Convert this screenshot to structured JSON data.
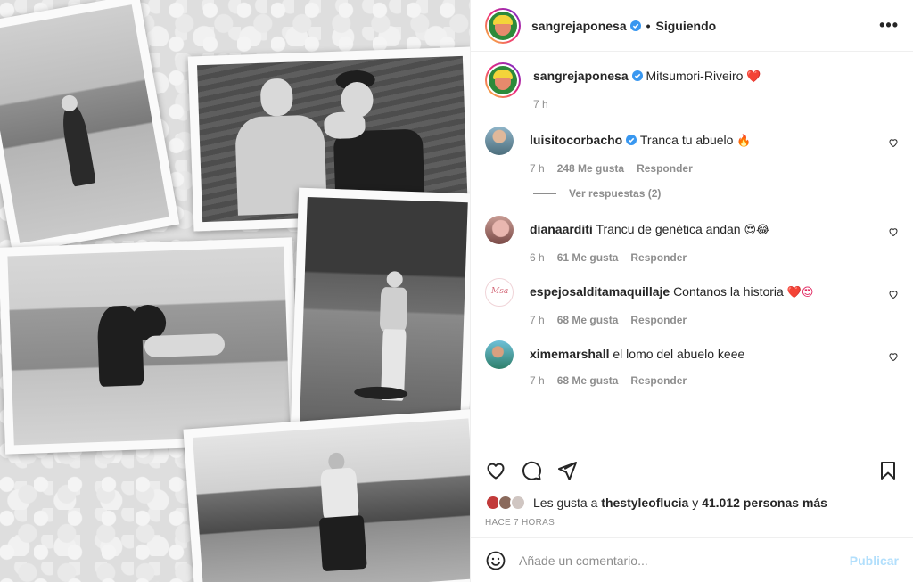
{
  "post": {
    "author": "sangrejaponesa",
    "follow_status": "Siguiendo",
    "more_icon": "more-options-icon",
    "verified_color": "#3897f0"
  },
  "caption": {
    "username": "sangrejaponesa",
    "text": "Mitsumori-Riveiro",
    "emoji": "❤️",
    "time": "7 h"
  },
  "comments": [
    {
      "username": "luisitocorbacho",
      "verified": true,
      "text": "Tranca tu abuelo",
      "emoji": "🔥",
      "time": "7 h",
      "likes": "248 Me gusta",
      "reply_label": "Responder"
    },
    {
      "username": "dianaarditi",
      "verified": false,
      "text": "Trancu de genética andan",
      "emoji": "😍😂",
      "time": "6 h",
      "likes": "61 Me gusta",
      "reply_label": "Responder"
    },
    {
      "username": "espejosalditamaquillaje",
      "verified": false,
      "text": "Contanos la historia",
      "emoji": "❤️😍",
      "time": "7 h",
      "likes": "68 Me gusta",
      "reply_label": "Responder"
    },
    {
      "username": "ximemarshall",
      "verified": false,
      "text": "el lomo del abuelo keee",
      "emoji": "",
      "time": "7 h",
      "likes": "68 Me gusta",
      "reply_label": "Responder"
    }
  ],
  "view_replies": "Ver respuestas (2)",
  "likes": {
    "prefix": "Les gusta a",
    "user": "thestyleoflucia",
    "connector": "y",
    "count": "41.012 personas más"
  },
  "posted_ago": "HACE 7 HORAS",
  "composer": {
    "placeholder": "Añade un comentario...",
    "publish_label": "Publicar"
  }
}
